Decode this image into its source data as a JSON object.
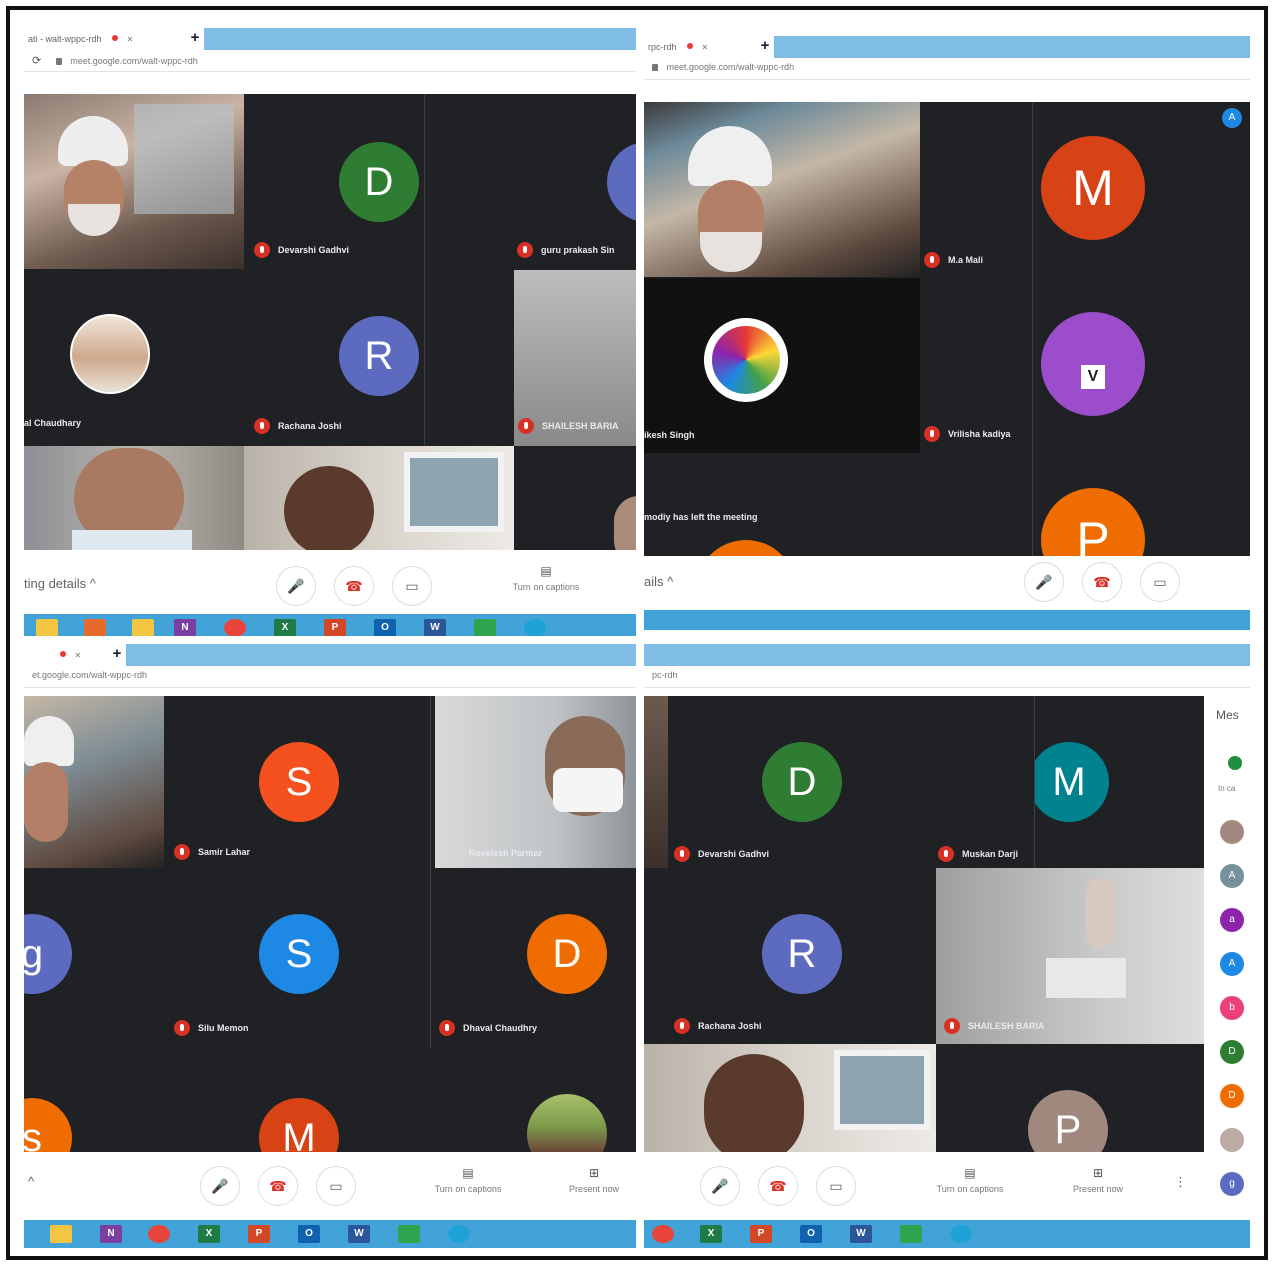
{
  "colors": {
    "meet_bg": "#202124",
    "tab_blue": "#7fbde6",
    "taskbar": "#42a3d8",
    "mic_red": "#d93025"
  },
  "q1": {
    "tab_title": "ati - walt-wppc-rdh",
    "url": "meet.google.com/walt-wppc-rdh",
    "tiles": [
      {
        "letter": "D",
        "name": "Devarshi Gadhvi"
      },
      {
        "letter": "",
        "name": "guru prakash Sin"
      },
      {
        "letter": "",
        "name": "al Chaudhary"
      },
      {
        "letter": "R",
        "name": "Rachana Joshi"
      },
      {
        "letter": "",
        "name": "SHAILESH BARIA"
      }
    ],
    "meeting_details": "ting details",
    "captions": "Turn on captions"
  },
  "q2": {
    "tab_title": "rpc-rdh",
    "url": "meet.google.com/walt-wppc-rdh",
    "tiles": [
      {
        "letter": "M",
        "name": "M.a Mali"
      },
      {
        "letter": "V",
        "name": "Vrilisha kadiya"
      },
      {
        "letter": "",
        "name": "ikesh Singh"
      },
      {
        "letter": "P",
        "name": ""
      }
    ],
    "left_notice": "modiy has left the meeting",
    "meeting_details": "ails",
    "badge": "A"
  },
  "q3": {
    "url": "et.google.com/walt-wppc-rdh",
    "tiles": [
      {
        "letter": "S",
        "name": "Samir Lahar"
      },
      {
        "letter": "",
        "name": "Ravelesh Parmar"
      },
      {
        "letter": "g",
        "name": ""
      },
      {
        "letter": "S",
        "name": "Silu Memon"
      },
      {
        "letter": "D",
        "name": "Dhaval Chaudhry"
      },
      {
        "letter": "s",
        "name": ""
      },
      {
        "letter": "M",
        "name": ""
      }
    ],
    "captions": "Turn on captions",
    "present": "Present now"
  },
  "q4": {
    "url": "pc-rdh",
    "tiles": [
      {
        "letter": "D",
        "name": "Devarshi Gadhvi"
      },
      {
        "letter": "M",
        "name": "Muskan Darji"
      },
      {
        "letter": "R",
        "name": "Rachana Joshi"
      },
      {
        "letter": "",
        "name": "SHAILESH BARIA"
      },
      {
        "letter": "P",
        "name": ""
      }
    ],
    "sidebar_title": "Mes",
    "sidebar_sub": "In ca",
    "sidebar_dots": [
      "",
      "A",
      "a",
      "A",
      "b",
      "D",
      "D",
      "",
      "g"
    ],
    "captions": "Turn on captions",
    "present": "Present now",
    "more": "⋮"
  }
}
